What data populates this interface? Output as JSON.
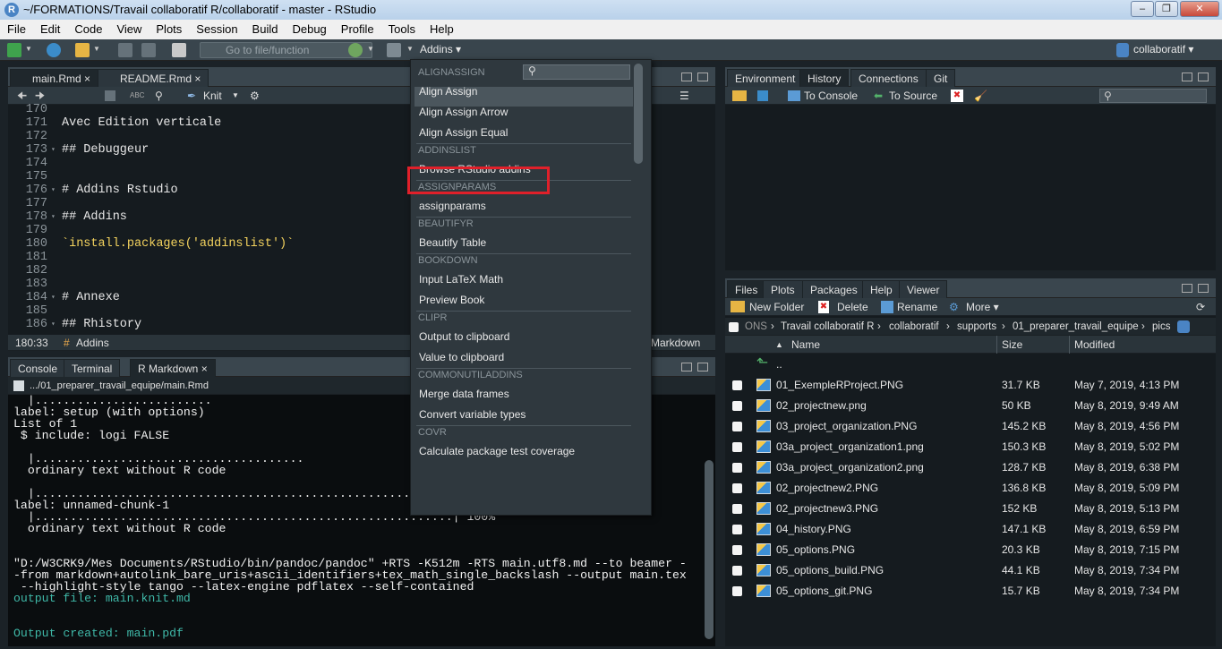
{
  "window": {
    "title": "~/FORMATIONS/Travail collaboratif R/collaboratif - master - RStudio",
    "app_logo": "R"
  },
  "menubar": [
    "File",
    "Edit",
    "Code",
    "View",
    "Plots",
    "Session",
    "Build",
    "Debug",
    "Profile",
    "Tools",
    "Help"
  ],
  "toolbar": {
    "goto_placeholder": "Go to file/function",
    "addins_label": "Addins",
    "project_label": "collaboratif"
  },
  "editor": {
    "tabs": [
      "main.Rmd",
      "README.Rmd"
    ],
    "knit_label": "Knit",
    "lines": [
      {
        "n": "170",
        "t": "",
        "k": "txt"
      },
      {
        "n": "171",
        "t": "Avec Edition verticale",
        "k": "txt"
      },
      {
        "n": "172",
        "t": "",
        "k": "txt"
      },
      {
        "n": "173",
        "t": "## Debuggeur",
        "k": "hdr"
      },
      {
        "n": "174",
        "t": "",
        "k": "txt"
      },
      {
        "n": "175",
        "t": "",
        "k": "txt"
      },
      {
        "n": "176",
        "t": "# Addins Rstudio",
        "k": "hdr"
      },
      {
        "n": "177",
        "t": "",
        "k": "txt"
      },
      {
        "n": "178",
        "t": "## Addins",
        "k": "hdr"
      },
      {
        "n": "179",
        "t": "",
        "k": "txt"
      },
      {
        "n": "180",
        "t": "`install.packages('addinslist')`",
        "k": "str"
      },
      {
        "n": "181",
        "t": "",
        "k": "txt"
      },
      {
        "n": "182",
        "t": "",
        "k": "txt"
      },
      {
        "n": "183",
        "t": "",
        "k": "txt"
      },
      {
        "n": "184",
        "t": "# Annexe",
        "k": "hdr"
      },
      {
        "n": "185",
        "t": "",
        "k": "txt"
      },
      {
        "n": "186",
        "t": "## Rhistory",
        "k": "hdr"
      }
    ],
    "status_pos": "180:33",
    "status_section": "Addins",
    "status_mode": "Markdown"
  },
  "console": {
    "tabs": [
      "Console",
      "Terminal",
      "R Markdown"
    ],
    "path": ".../01_preparer_travail_equipe/main.Rmd",
    "lines": [
      {
        "t": "  |.........................",
        "c": ""
      },
      {
        "t": "label: setup (with options)",
        "c": ""
      },
      {
        "t": "List of 1",
        "c": ""
      },
      {
        "t": " $ include: logi FALSE",
        "c": ""
      },
      {
        "t": "",
        "c": ""
      },
      {
        "t": "  |......................................",
        "c": ""
      },
      {
        "t": "  ordinary text without R code",
        "c": ""
      },
      {
        "t": "",
        "c": ""
      },
      {
        "t": "  |...........................................................",
        "c": ""
      },
      {
        "t": "label: unnamed-chunk-1",
        "c": ""
      },
      {
        "t": "  |...........................................................| 100%",
        "c": ""
      },
      {
        "t": "  ordinary text without R code",
        "c": ""
      },
      {
        "t": "",
        "c": ""
      },
      {
        "t": "",
        "c": ""
      },
      {
        "t": "\"D:/W3CRK9/Mes Documents/RStudio/bin/pandoc/pandoc\" +RTS -K512m -RTS main.utf8.md --to beamer -",
        "c": ""
      },
      {
        "t": "-from markdown+autolink_bare_uris+ascii_identifiers+tex_math_single_backslash --output main.tex",
        "c": ""
      },
      {
        "t": " --highlight-style tango --latex-engine pdflatex --self-contained",
        "c": ""
      },
      {
        "t": "output file: main.knit.md",
        "c": "cy"
      },
      {
        "t": "",
        "c": ""
      },
      {
        "t": "",
        "c": ""
      },
      {
        "t": "Output created: main.pdf",
        "c": "cy"
      }
    ]
  },
  "env": {
    "tabs": [
      "Environment",
      "History",
      "Connections",
      "Git"
    ],
    "to_console": "To Console",
    "to_source": "To Source"
  },
  "files": {
    "tabs": [
      "Files",
      "Plots",
      "Packages",
      "Help",
      "Viewer"
    ],
    "new_folder": "New Folder",
    "delete": "Delete",
    "rename": "Rename",
    "more": "More",
    "breadcrumb": [
      "ONS",
      "Travail collaboratif R",
      "collaboratif",
      "supports",
      "01_preparer_travail_equipe",
      "pics"
    ],
    "col_name": "Name",
    "col_size": "Size",
    "col_modified": "Modified",
    "parent": "..",
    "rows": [
      {
        "name": "01_ExempleRProject.PNG",
        "size": "31.7 KB",
        "modified": "May 7, 2019, 4:13 PM"
      },
      {
        "name": "02_projectnew.png",
        "size": "50 KB",
        "modified": "May 8, 2019, 9:49 AM"
      },
      {
        "name": "03_project_organization.PNG",
        "size": "145.2 KB",
        "modified": "May 8, 2019, 4:56 PM"
      },
      {
        "name": "03a_project_organization1.png",
        "size": "150.3 KB",
        "modified": "May 8, 2019, 5:02 PM"
      },
      {
        "name": "03a_project_organization2.png",
        "size": "128.7 KB",
        "modified": "May 8, 2019, 6:38 PM"
      },
      {
        "name": "02_projectnew2.PNG",
        "size": "136.8 KB",
        "modified": "May 8, 2019, 5:09 PM"
      },
      {
        "name": "02_projectnew3.PNG",
        "size": "152 KB",
        "modified": "May 8, 2019, 5:13 PM"
      },
      {
        "name": "04_history.PNG",
        "size": "147.1 KB",
        "modified": "May 8, 2019, 6:59 PM"
      },
      {
        "name": "05_options.PNG",
        "size": "20.3 KB",
        "modified": "May 8, 2019, 7:15 PM"
      },
      {
        "name": "05_options_build.PNG",
        "size": "44.1 KB",
        "modified": "May 8, 2019, 7:34 PM"
      },
      {
        "name": "05_options_git.PNG",
        "size": "15.7 KB",
        "modified": "May 8, 2019, 7:34 PM"
      }
    ]
  },
  "addins_menu": {
    "entries": [
      {
        "type": "section",
        "label": "ALIGNASSIGN"
      },
      {
        "type": "item",
        "label": "Align Assign"
      },
      {
        "type": "item",
        "label": "Align Assign Arrow"
      },
      {
        "type": "item",
        "label": "Align Assign Equal"
      },
      {
        "type": "section",
        "label": "ADDINSLIST"
      },
      {
        "type": "item",
        "label": "Browse RStudio addins"
      },
      {
        "type": "section",
        "label": "ASSIGNPARAMS"
      },
      {
        "type": "item",
        "label": "assignparams"
      },
      {
        "type": "section",
        "label": "BEAUTIFYR"
      },
      {
        "type": "item",
        "label": "Beautify Table"
      },
      {
        "type": "section",
        "label": "BOOKDOWN"
      },
      {
        "type": "item",
        "label": "Input LaTeX Math"
      },
      {
        "type": "item",
        "label": "Preview Book"
      },
      {
        "type": "section",
        "label": "CLIPR"
      },
      {
        "type": "item",
        "label": "Output to clipboard"
      },
      {
        "type": "item",
        "label": "Value to clipboard"
      },
      {
        "type": "section",
        "label": "COMMONUTILADDINS"
      },
      {
        "type": "item",
        "label": "Merge data frames"
      },
      {
        "type": "item",
        "label": "Convert variable types"
      },
      {
        "type": "section",
        "label": "COVR"
      },
      {
        "type": "item",
        "label": "Calculate package test coverage"
      }
    ]
  },
  "colors": {
    "highlight_box": "#e0202a",
    "console_cyan": "#3fb8a8",
    "code_string": "#f4d35e"
  }
}
